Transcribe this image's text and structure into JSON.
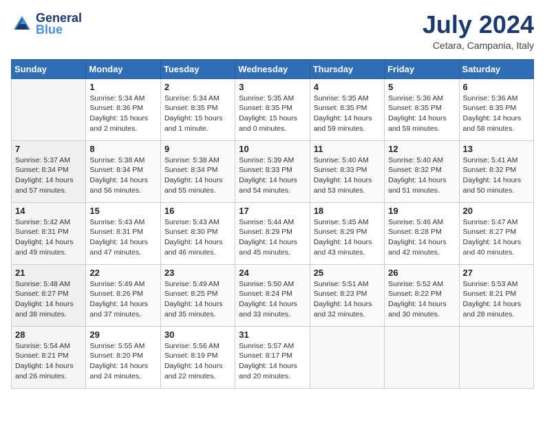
{
  "header": {
    "logo_line1": "General",
    "logo_line2": "Blue",
    "month_title": "July 2024",
    "location": "Cetara, Campania, Italy"
  },
  "days_of_week": [
    "Sunday",
    "Monday",
    "Tuesday",
    "Wednesday",
    "Thursday",
    "Friday",
    "Saturday"
  ],
  "weeks": [
    [
      {
        "day": "",
        "info": ""
      },
      {
        "day": "1",
        "info": "Sunrise: 5:34 AM\nSunset: 8:36 PM\nDaylight: 15 hours\nand 2 minutes."
      },
      {
        "day": "2",
        "info": "Sunrise: 5:34 AM\nSunset: 8:35 PM\nDaylight: 15 hours\nand 1 minute."
      },
      {
        "day": "3",
        "info": "Sunrise: 5:35 AM\nSunset: 8:35 PM\nDaylight: 15 hours\nand 0 minutes."
      },
      {
        "day": "4",
        "info": "Sunrise: 5:35 AM\nSunset: 8:35 PM\nDaylight: 14 hours\nand 59 minutes."
      },
      {
        "day": "5",
        "info": "Sunrise: 5:36 AM\nSunset: 8:35 PM\nDaylight: 14 hours\nand 59 minutes."
      },
      {
        "day": "6",
        "info": "Sunrise: 5:36 AM\nSunset: 8:35 PM\nDaylight: 14 hours\nand 58 minutes."
      }
    ],
    [
      {
        "day": "7",
        "info": "Sunrise: 5:37 AM\nSunset: 8:34 PM\nDaylight: 14 hours\nand 57 minutes."
      },
      {
        "day": "8",
        "info": "Sunrise: 5:38 AM\nSunset: 8:34 PM\nDaylight: 14 hours\nand 56 minutes."
      },
      {
        "day": "9",
        "info": "Sunrise: 5:38 AM\nSunset: 8:34 PM\nDaylight: 14 hours\nand 55 minutes."
      },
      {
        "day": "10",
        "info": "Sunrise: 5:39 AM\nSunset: 8:33 PM\nDaylight: 14 hours\nand 54 minutes."
      },
      {
        "day": "11",
        "info": "Sunrise: 5:40 AM\nSunset: 8:33 PM\nDaylight: 14 hours\nand 53 minutes."
      },
      {
        "day": "12",
        "info": "Sunrise: 5:40 AM\nSunset: 8:32 PM\nDaylight: 14 hours\nand 51 minutes."
      },
      {
        "day": "13",
        "info": "Sunrise: 5:41 AM\nSunset: 8:32 PM\nDaylight: 14 hours\nand 50 minutes."
      }
    ],
    [
      {
        "day": "14",
        "info": "Sunrise: 5:42 AM\nSunset: 8:31 PM\nDaylight: 14 hours\nand 49 minutes."
      },
      {
        "day": "15",
        "info": "Sunrise: 5:43 AM\nSunset: 8:31 PM\nDaylight: 14 hours\nand 47 minutes."
      },
      {
        "day": "16",
        "info": "Sunrise: 5:43 AM\nSunset: 8:30 PM\nDaylight: 14 hours\nand 46 minutes."
      },
      {
        "day": "17",
        "info": "Sunrise: 5:44 AM\nSunset: 8:29 PM\nDaylight: 14 hours\nand 45 minutes."
      },
      {
        "day": "18",
        "info": "Sunrise: 5:45 AM\nSunset: 8:29 PM\nDaylight: 14 hours\nand 43 minutes."
      },
      {
        "day": "19",
        "info": "Sunrise: 5:46 AM\nSunset: 8:28 PM\nDaylight: 14 hours\nand 42 minutes."
      },
      {
        "day": "20",
        "info": "Sunrise: 5:47 AM\nSunset: 8:27 PM\nDaylight: 14 hours\nand 40 minutes."
      }
    ],
    [
      {
        "day": "21",
        "info": "Sunrise: 5:48 AM\nSunset: 8:27 PM\nDaylight: 14 hours\nand 38 minutes."
      },
      {
        "day": "22",
        "info": "Sunrise: 5:49 AM\nSunset: 8:26 PM\nDaylight: 14 hours\nand 37 minutes."
      },
      {
        "day": "23",
        "info": "Sunrise: 5:49 AM\nSunset: 8:25 PM\nDaylight: 14 hours\nand 35 minutes."
      },
      {
        "day": "24",
        "info": "Sunrise: 5:50 AM\nSunset: 8:24 PM\nDaylight: 14 hours\nand 33 minutes."
      },
      {
        "day": "25",
        "info": "Sunrise: 5:51 AM\nSunset: 8:23 PM\nDaylight: 14 hours\nand 32 minutes."
      },
      {
        "day": "26",
        "info": "Sunrise: 5:52 AM\nSunset: 8:22 PM\nDaylight: 14 hours\nand 30 minutes."
      },
      {
        "day": "27",
        "info": "Sunrise: 5:53 AM\nSunset: 8:21 PM\nDaylight: 14 hours\nand 28 minutes."
      }
    ],
    [
      {
        "day": "28",
        "info": "Sunrise: 5:54 AM\nSunset: 8:21 PM\nDaylight: 14 hours\nand 26 minutes."
      },
      {
        "day": "29",
        "info": "Sunrise: 5:55 AM\nSunset: 8:20 PM\nDaylight: 14 hours\nand 24 minutes."
      },
      {
        "day": "30",
        "info": "Sunrise: 5:56 AM\nSunset: 8:19 PM\nDaylight: 14 hours\nand 22 minutes."
      },
      {
        "day": "31",
        "info": "Sunrise: 5:57 AM\nSunset: 8:17 PM\nDaylight: 14 hours\nand 20 minutes."
      },
      {
        "day": "",
        "info": ""
      },
      {
        "day": "",
        "info": ""
      },
      {
        "day": "",
        "info": ""
      }
    ]
  ]
}
